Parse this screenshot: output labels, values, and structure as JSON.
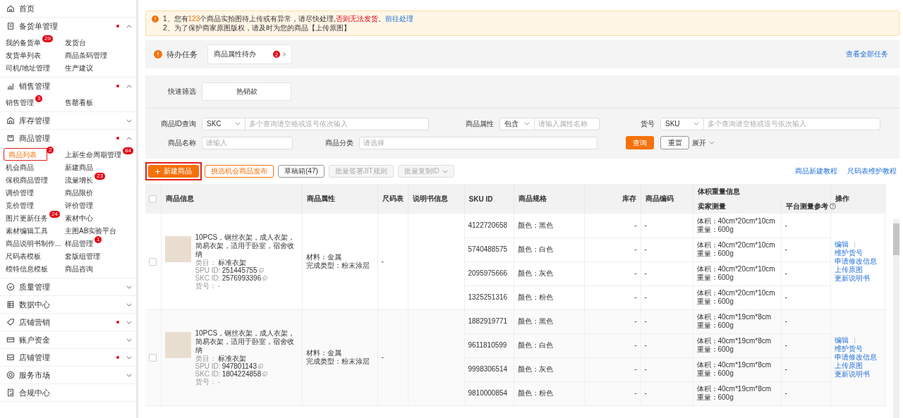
{
  "sidebar": [
    {
      "label": "首页",
      "kind": "link",
      "dot": false
    },
    {
      "label": "备货单管理",
      "kind": "group",
      "dot": true,
      "expanded": true,
      "children": [
        {
          "label": "我的备货单",
          "badge": "29",
          "selected": false
        },
        {
          "label": "发货台",
          "selected": false
        },
        {
          "label": "发货单列表",
          "selected": false
        },
        {
          "label": "商品条码管理",
          "selected": false
        },
        {
          "label": "司机/地址管理",
          "selected": false
        },
        {
          "label": "生产建议",
          "selected": false
        }
      ]
    },
    {
      "label": "销售管理",
      "kind": "group",
      "dot": true,
      "expanded": true,
      "children": [
        {
          "label": "销售管理",
          "badge": "3",
          "selected": false
        },
        {
          "label": "售罄看板",
          "selected": false
        }
      ]
    },
    {
      "label": "库存管理",
      "kind": "group",
      "dot": false,
      "expanded": false
    },
    {
      "label": "商品管理",
      "kind": "group",
      "dot": true,
      "expanded": true,
      "children": [
        {
          "label": "商品列表",
          "badge": "2",
          "selected": true
        },
        {
          "label": "上新生命周期管理",
          "badge": "84",
          "selected": false
        },
        {
          "label": "机会商品",
          "selected": false
        },
        {
          "label": "新建商品",
          "selected": false
        },
        {
          "label": "保税商品管理",
          "selected": false
        },
        {
          "label": "流量增长",
          "badge": "23",
          "selected": false
        },
        {
          "label": "调价管理",
          "selected": false
        },
        {
          "label": "商品限价",
          "selected": false
        },
        {
          "label": "竞价管理",
          "selected": false
        },
        {
          "label": "评价管理",
          "selected": false
        },
        {
          "label": "图片更新任务",
          "badge": "24",
          "selected": false
        },
        {
          "label": "素材中心",
          "selected": false
        },
        {
          "label": "素材编辑工具",
          "selected": false
        },
        {
          "label": "主图AB实验平台",
          "selected": false
        },
        {
          "label": "商品说明书制作...",
          "selected": false
        },
        {
          "label": "样品管理",
          "badge": "1",
          "selected": false
        },
        {
          "label": "尺码表模板",
          "selected": false
        },
        {
          "label": "套版组管理",
          "selected": false
        },
        {
          "label": "模特信息模板",
          "selected": false
        },
        {
          "label": "商品咨询",
          "selected": false
        }
      ]
    },
    {
      "label": "质量管理",
      "kind": "group",
      "dot": false,
      "expanded": false
    },
    {
      "label": "数据中心",
      "kind": "group",
      "dot": false,
      "expanded": false
    },
    {
      "label": "店铺营销",
      "kind": "group",
      "dot": true,
      "expanded": false
    },
    {
      "label": "账户资金",
      "kind": "group",
      "dot": false,
      "expanded": false
    },
    {
      "label": "店铺管理",
      "kind": "group",
      "dot": true,
      "expanded": false
    },
    {
      "label": "服务市场",
      "kind": "group",
      "dot": false,
      "expanded": false
    },
    {
      "label": "合规中心",
      "kind": "link",
      "dot": false
    }
  ],
  "notice": {
    "lines": [
      [
        {
          "kind": "text",
          "text": "1、您有"
        },
        {
          "kind": "count",
          "text": "123"
        },
        {
          "kind": "text",
          "text": "个商品实拍图待上传或有异常，请尽快处理,"
        },
        {
          "kind": "warning",
          "text": "否则无法发货"
        },
        {
          "kind": "text",
          "text": "。"
        },
        {
          "kind": "link",
          "text": "前往处理"
        }
      ],
      [
        {
          "kind": "text",
          "text": "2、为了保护商家原图版权，请及时为您的商品【上传原图】"
        }
      ]
    ]
  },
  "todo": {
    "title": "待办任务",
    "cards": [
      {
        "label": "商品属性待办",
        "badge": "2"
      }
    ],
    "view_all": "查看全部任务"
  },
  "quick_filter": {
    "label": "快速筛选",
    "options": [
      {
        "label": "热销款",
        "selected": false
      }
    ]
  },
  "filter_rows": [
    [
      {
        "label": "商品ID查询",
        "kind": "select_input",
        "select": "SKC",
        "placeholder": "多个查询请空格或逗号依次输入"
      },
      {
        "label": "商品属性",
        "kind": "select_input",
        "select": "包含",
        "placeholder": "请输入属性名称"
      },
      {
        "label": "货号",
        "kind": "select_input",
        "select": "SKU",
        "placeholder": "多个查询请空格或逗号依次输入"
      }
    ],
    [
      {
        "label": "商品名称",
        "kind": "input",
        "placeholder": "请输入"
      },
      {
        "label": "商品分类",
        "kind": "input",
        "placeholder": "请选择"
      }
    ]
  ],
  "search_button": "查询",
  "reset_button": "重置",
  "expand_toggle": {
    "label": "展开",
    "expanded": false
  },
  "actions": [
    {
      "label": "新建商品",
      "kind": "primary",
      "disabled": false,
      "highlighted": true
    },
    {
      "label": "挑选机会商品发布",
      "kind": "outline",
      "disabled": false,
      "highlighted": false
    },
    {
      "label": "草稿箱(47)",
      "kind": "default",
      "disabled": false,
      "highlighted": false
    },
    {
      "label": "批量签署JIT规则",
      "kind": "default",
      "disabled": true,
      "highlighted": false
    },
    {
      "label": "批量复制ID",
      "kind": "dropdown",
      "disabled": true,
      "highlighted": false
    }
  ],
  "help_links": [
    "商品新建教程",
    "尺码表维护教程"
  ],
  "table": {
    "all_checked": false,
    "columns": [
      {
        "label": "商品信息"
      },
      {
        "label": "商品属性"
      },
      {
        "label": "尺码表"
      },
      {
        "label": "说明书信息"
      },
      {
        "label": "SKU ID"
      },
      {
        "label": "商品规格"
      },
      {
        "label": "库存"
      },
      {
        "label": "商品编码"
      },
      {
        "label": "体积重量信息",
        "children": [
          {
            "label": "卖家测量",
            "help": false
          },
          {
            "label": "平台测量参考",
            "help": true
          }
        ]
      },
      {
        "label": "操作"
      }
    ],
    "products": [
      {
        "checked": false,
        "title": "10PCS，钢丝衣架，成人衣架，简易衣架，适用于卧室，宿舍收纳",
        "category_label": "类目：",
        "category": "标准衣架",
        "spu_label": "SPU ID:",
        "spu_id": "251445755",
        "skc_label": "SKC ID:",
        "skc_id": "2576993396",
        "article_label": "货号：",
        "article": "-",
        "attributes": [
          "材料：金属",
          "完成类型：粉末涂层"
        ],
        "size_chart": "-",
        "actions": [
          "编辑",
          "维护货号",
          "申请修改信息",
          "上传原图",
          "更新说明书"
        ],
        "skus": [
          {
            "id": "4122720658",
            "spec": "颜色：黑色",
            "stock": "-",
            "code": "-",
            "volume": "体积：40cm*20cm*10cm",
            "weight": "重量：600g",
            "platform": "-"
          },
          {
            "id": "5740488575",
            "spec": "颜色：白色",
            "stock": "-",
            "code": "-",
            "volume": "体积：40cm*20cm*10cm",
            "weight": "重量：600g",
            "platform": "-"
          },
          {
            "id": "2095975666",
            "spec": "颜色：灰色",
            "stock": "-",
            "code": "-",
            "volume": "体积：40cm*20cm*10cm",
            "weight": "重量：600g",
            "platform": "-"
          },
          {
            "id": "1325251316",
            "spec": "颜色：粉色",
            "stock": "-",
            "code": "-",
            "volume": "体积：40cm*20cm*10cm",
            "weight": "重量：600g",
            "platform": "-"
          }
        ]
      },
      {
        "checked": false,
        "title": "10PCS，钢丝衣架，成人衣架，简易衣架，适用于卧室，宿舍收纳",
        "category_label": "类目：",
        "category": "标准衣架",
        "spu_label": "SPU ID:",
        "spu_id": "947801143",
        "skc_label": "SKC ID:",
        "skc_id": "1804224858",
        "article_label": "货号：",
        "article": "-",
        "attributes": [
          "材料：金属",
          "完成类型：粉末涂层"
        ],
        "size_chart": "-",
        "actions": [
          "编辑",
          "维护货号",
          "申请修改信息",
          "上传原图",
          "更新说明书"
        ],
        "skus": [
          {
            "id": "1882919771",
            "spec": "颜色：黑色",
            "stock": "-",
            "code": "-",
            "volume": "体积：40cm*19cm*8cm",
            "weight": "重量：600g",
            "platform": "-"
          },
          {
            "id": "9611810599",
            "spec": "颜色：白色",
            "stock": "-",
            "code": "-",
            "volume": "体积：40cm*19cm*8cm",
            "weight": "重量：600g",
            "platform": "-"
          },
          {
            "id": "9998306514",
            "spec": "颜色：灰色",
            "stock": "-",
            "code": "-",
            "volume": "体积：40cm*19cm*8cm",
            "weight": "重量：600g",
            "platform": "-"
          },
          {
            "id": "9810000854",
            "spec": "颜色：粉色",
            "stock": "-",
            "code": "-",
            "volume": "体积：40cm*19cm*8cm",
            "weight": "重量：600g",
            "platform": "-"
          }
        ]
      }
    ]
  }
}
